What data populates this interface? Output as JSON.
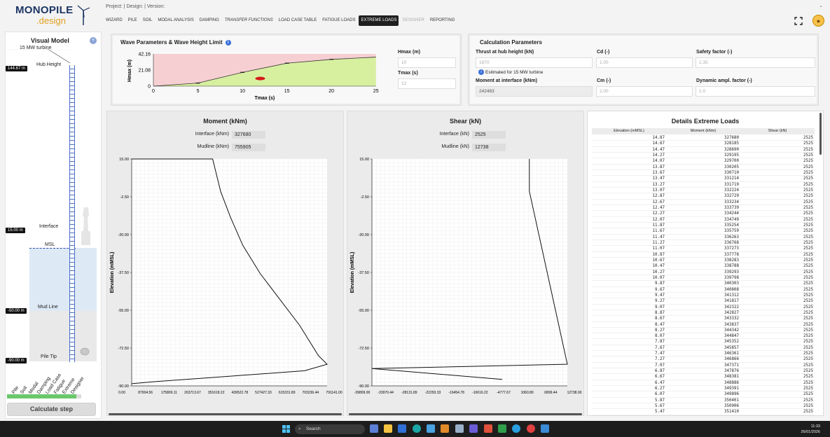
{
  "app": {
    "logo_line1": "MONOPILE",
    "logo_line2": ".design",
    "project_line": "Project: | Design: | Version:"
  },
  "tabs": [
    {
      "label": "WIZARD",
      "state": "normal"
    },
    {
      "label": "PILE",
      "state": "normal"
    },
    {
      "label": "SOIL",
      "state": "normal"
    },
    {
      "label": "MODAL ANALYSIS",
      "state": "normal"
    },
    {
      "label": "DAMPING",
      "state": "normal"
    },
    {
      "label": "TRANSFER FUNCTIONS",
      "state": "italic"
    },
    {
      "label": "LOAD CASE TABLE",
      "state": "normal"
    },
    {
      "label": "FATIGUE LOADS",
      "state": "normal"
    },
    {
      "label": "EXTREME LOADS",
      "state": "active"
    },
    {
      "label": "DESIGNER",
      "state": "disabled"
    },
    {
      "label": "REPORTING",
      "state": "normal"
    }
  ],
  "visual_model": {
    "title": "Visual Model",
    "turbine_label": "15 MW turbine",
    "hub_label": "Hub Height",
    "hub_tag": "144.67 m",
    "interface_label": "Interface",
    "interface_tag": "15.00 m",
    "msl_label": "MSL",
    "mudline_label": "Mud Line",
    "mudline_tag": "-50.00 m",
    "piletip_label": "Pile Tip",
    "piletip_tag": "-90.00 m",
    "steps": [
      "Pile",
      "Soil",
      "Modal",
      "Damping",
      "Load Case",
      "Fatigue",
      "Extreme",
      "Designer"
    ],
    "progress": 0.93,
    "calc_button": "Calculate step"
  },
  "wave": {
    "title": "Wave Parameters & Wave Height Limit",
    "hmax_label": "Hmax (m)",
    "hmax_placeholder": "10",
    "tmax_label": "Tmax (s)",
    "tmax_placeholder": "12",
    "chart": {
      "ylabel": "Hmax (m)",
      "xlabel": "Tmax (s)",
      "yticks": [
        "42.16",
        "21.08",
        "0"
      ],
      "xticks": [
        "0",
        "5",
        "10",
        "15",
        "20",
        "25"
      ],
      "points_x": [
        0,
        5,
        10,
        15,
        20,
        25
      ],
      "points_y": [
        0,
        4,
        18,
        30,
        35,
        38
      ],
      "marker": {
        "x": 12,
        "y": 10
      }
    }
  },
  "calc": {
    "title": "Calculation Parameters",
    "thrust_label": "Thrust at hub height (kN)",
    "thrust_value": "1870",
    "thrust_note": "Estimated for 15 MW turbine",
    "cd_label": "Cd (-)",
    "cd_value": "1.00",
    "sf_label": "Safety factor (-)",
    "sf_value": "1.35",
    "moment_label": "Moment at interface (kNm)",
    "moment_value": "242483",
    "cm_label": "Cm (-)",
    "cm_value": "2.00",
    "daf_label": "Dynamic ampl. factor (-)",
    "daf_value": "1.0"
  },
  "moment": {
    "title": "Moment (kNm)",
    "interface_label": "Interface (kNm)",
    "interface_value": "327680",
    "mudline_label": "Mudline (kNm)",
    "mudline_value": "755905"
  },
  "shear": {
    "title": "Shear (kN)",
    "interface_label": "Interface (kN)",
    "interface_value": "2525",
    "mudline_label": "Mudline (kN)",
    "mudline_value": "12738"
  },
  "chart_data": [
    {
      "type": "line",
      "title": "Moment (kNm)",
      "ylabel": "Elevation (mMSL)",
      "xlabel": "",
      "yticks": [
        "15.00",
        "-2.50",
        "-20.00",
        "-37.50",
        "-55.00",
        "-72.50",
        "-90.00"
      ],
      "xticks": [
        "0.00",
        "87904.56",
        "175809.11",
        "263713.67",
        "351618.22",
        "439522.78",
        "527427.33",
        "615331.89",
        "703236.44",
        "791141.00"
      ],
      "xlim": [
        0,
        791141
      ],
      "ylim": [
        -90,
        15
      ],
      "x": [
        0,
        327680,
        360000,
        400000,
        450000,
        520000,
        600000,
        680000,
        755905,
        791000,
        700000,
        400000,
        100000,
        0
      ],
      "y": [
        15,
        15,
        0,
        -12,
        -25,
        -38,
        -50,
        -62,
        -76,
        -80,
        -83,
        -85.5,
        -88,
        -89
      ],
      "series": [
        {
          "values": [
            15
          ]
        }
      ]
    },
    {
      "type": "line",
      "title": "Shear (kN)",
      "ylabel": "Elevation (mMSL)",
      "xlabel": "",
      "yticks": [
        "15.00",
        "-2.50",
        "-20.00",
        "-37.50",
        "-55.00",
        "-72.50",
        "-90.00"
      ],
      "xticks": [
        "-39809.00",
        "-33970.44",
        "-28131.89",
        "-22293.33",
        "-16454.78",
        "-10616.22",
        "-4777.67",
        "1060.89",
        "6899.44",
        "12738.00"
      ],
      "xlim": [
        -39809,
        12738
      ],
      "ylim": [
        -90,
        15
      ],
      "x": [
        2525,
        2525,
        12738,
        -39809,
        -4778
      ],
      "y": [
        15,
        0,
        -80,
        -82,
        -87
      ],
      "series": [
        {
          "values": [
            15
          ]
        }
      ]
    }
  ],
  "details": {
    "title": "Details Extreme Loads",
    "columns": [
      "Elevation (mMSL)",
      "Moment (kNm)",
      "Shear (kN)"
    ],
    "rows": [
      [
        "14.87",
        "327680",
        "2525"
      ],
      [
        "14.67",
        "328185",
        "2525"
      ],
      [
        "14.47",
        "328690",
        "2525"
      ],
      [
        "14.27",
        "329195",
        "2525"
      ],
      [
        "14.07",
        "329700",
        "2525"
      ],
      [
        "13.87",
        "330205",
        "2525"
      ],
      [
        "13.67",
        "330710",
        "2525"
      ],
      [
        "13.47",
        "331214",
        "2525"
      ],
      [
        "13.27",
        "331719",
        "2525"
      ],
      [
        "13.07",
        "332224",
        "2525"
      ],
      [
        "12.87",
        "332729",
        "2525"
      ],
      [
        "12.67",
        "333234",
        "2525"
      ],
      [
        "12.47",
        "333739",
        "2525"
      ],
      [
        "12.27",
        "334244",
        "2525"
      ],
      [
        "12.07",
        "334749",
        "2525"
      ],
      [
        "11.87",
        "335254",
        "2525"
      ],
      [
        "11.67",
        "335759",
        "2525"
      ],
      [
        "11.47",
        "336263",
        "2525"
      ],
      [
        "11.27",
        "336768",
        "2525"
      ],
      [
        "11.07",
        "337273",
        "2525"
      ],
      [
        "10.87",
        "337778",
        "2525"
      ],
      [
        "10.67",
        "338283",
        "2525"
      ],
      [
        "10.47",
        "338788",
        "2525"
      ],
      [
        "10.27",
        "339293",
        "2525"
      ],
      [
        "10.07",
        "339798",
        "2525"
      ],
      [
        "9.87",
        "340303",
        "2525"
      ],
      [
        "9.67",
        "340808",
        "2525"
      ],
      [
        "9.47",
        "341312",
        "2525"
      ],
      [
        "9.27",
        "341817",
        "2525"
      ],
      [
        "9.07",
        "342322",
        "2525"
      ],
      [
        "8.87",
        "342827",
        "2525"
      ],
      [
        "8.67",
        "343332",
        "2525"
      ],
      [
        "8.47",
        "343837",
        "2525"
      ],
      [
        "8.27",
        "344342",
        "2525"
      ],
      [
        "8.07",
        "344847",
        "2525"
      ],
      [
        "7.87",
        "345352",
        "2525"
      ],
      [
        "7.67",
        "345857",
        "2525"
      ],
      [
        "7.47",
        "346361",
        "2525"
      ],
      [
        "7.27",
        "346866",
        "2525"
      ],
      [
        "7.07",
        "347371",
        "2525"
      ],
      [
        "6.87",
        "347876",
        "2525"
      ],
      [
        "6.67",
        "348381",
        "2525"
      ],
      [
        "6.47",
        "348886",
        "2525"
      ],
      [
        "6.27",
        "349391",
        "2525"
      ],
      [
        "6.07",
        "349896",
        "2525"
      ],
      [
        "5.87",
        "350401",
        "2525"
      ],
      [
        "5.67",
        "350906",
        "2525"
      ],
      [
        "5.47",
        "351410",
        "2525"
      ]
    ]
  },
  "taskbar": {
    "search_placeholder": "Search",
    "time": "11:33",
    "date": "26/01/2026"
  },
  "colors": {
    "accent": "#1f1f1f",
    "wave_allowed": "#d7f0a0",
    "wave_limit": "#f6cfd2",
    "marker": "#d61a1a",
    "tower": "#4a6fc4"
  }
}
